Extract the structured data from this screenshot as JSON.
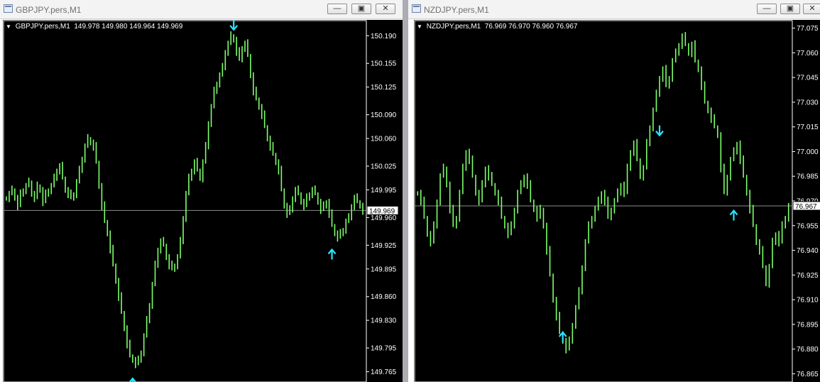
{
  "windows": [
    {
      "id": "left",
      "title": "GBPJPY.pers,M1",
      "header": {
        "symbol": "GBPJPY.pers,M1",
        "open": "149.978",
        "high": "149.980",
        "low": "149.964",
        "close": "149.969"
      },
      "current_price": "149.969",
      "axis_labels": [
        "150.190",
        "150.155",
        "150.125",
        "150.090",
        "150.060",
        "150.025",
        "149.995",
        "149.960",
        "149.925",
        "149.895",
        "149.860",
        "149.830",
        "149.795",
        "149.765"
      ],
      "axis_range": [
        149.752,
        150.21
      ],
      "buttons": {
        "minimize": "—",
        "maximize": "▣",
        "close": "✕"
      },
      "series": [
        149.985,
        149.99,
        149.995,
        149.985,
        149.975,
        149.99,
        149.995,
        150.0,
        150.005,
        149.99,
        149.985,
        150.0,
        149.995,
        149.98,
        149.99,
        149.995,
        150.0,
        150.01,
        150.02,
        150.025,
        150.01,
        149.995,
        149.99,
        149.985,
        149.99,
        150.005,
        150.02,
        150.035,
        150.05,
        150.06,
        150.055,
        150.05,
        150.03,
        150.0,
        149.975,
        149.955,
        149.94,
        149.92,
        149.9,
        149.88,
        149.86,
        149.84,
        149.82,
        149.8,
        149.785,
        149.78,
        149.775,
        149.78,
        149.79,
        149.81,
        149.83,
        149.85,
        149.875,
        149.9,
        149.92,
        149.93,
        149.925,
        149.91,
        149.9,
        149.895,
        149.9,
        149.91,
        149.93,
        149.96,
        149.99,
        150.01,
        150.02,
        150.03,
        150.02,
        150.01,
        150.03,
        150.05,
        150.08,
        150.1,
        150.12,
        150.13,
        150.14,
        150.15,
        150.17,
        150.18,
        150.19,
        150.185,
        150.17,
        150.16,
        150.175,
        150.18,
        150.165,
        150.14,
        150.12,
        150.11,
        150.1,
        150.09,
        150.075,
        150.06,
        150.05,
        150.04,
        150.03,
        150.02,
        149.995,
        149.975,
        149.965,
        149.97,
        149.985,
        149.995,
        149.99,
        149.98,
        149.975,
        149.985,
        149.99,
        149.995,
        149.99,
        149.98,
        149.97,
        149.975,
        149.98,
        149.965,
        149.95,
        149.94,
        149.935,
        149.94,
        149.945,
        149.955,
        149.96,
        149.975,
        149.985,
        149.98,
        149.975,
        149.969
      ],
      "arrows": [
        {
          "direction": "up",
          "index": 45,
          "price": 149.752
        },
        {
          "direction": "down",
          "index": 81,
          "price": 150.202
        },
        {
          "direction": "up",
          "index": 116,
          "price": 149.915
        }
      ]
    },
    {
      "id": "right",
      "title": "NZDJPY.pers,M1",
      "header": {
        "symbol": "NZDJPY.pers,M1",
        "open": "76.969",
        "high": "76.970",
        "low": "76.960",
        "close": "76.967"
      },
      "current_price": "76.967",
      "axis_labels": [
        "77.075",
        "77.060",
        "77.045",
        "77.030",
        "77.015",
        "77.000",
        "76.985",
        "76.970",
        "76.955",
        "76.940",
        "76.925",
        "76.910",
        "76.895",
        "76.880",
        "76.865"
      ],
      "axis_range": [
        76.86,
        77.08
      ],
      "buttons": {
        "minimize": "—",
        "maximize": "▣",
        "close": "✕"
      },
      "series": [
        76.975,
        76.97,
        76.96,
        76.95,
        76.945,
        76.955,
        76.97,
        76.985,
        76.99,
        76.98,
        76.965,
        76.955,
        76.96,
        76.975,
        76.99,
        77.0,
        76.995,
        76.985,
        76.975,
        76.97,
        76.98,
        76.99,
        76.985,
        76.98,
        76.975,
        76.97,
        76.96,
        76.955,
        76.95,
        76.955,
        76.965,
        76.975,
        76.98,
        76.985,
        76.98,
        76.97,
        76.965,
        76.96,
        76.965,
        76.955,
        76.94,
        76.925,
        76.91,
        76.9,
        76.89,
        76.885,
        76.88,
        76.885,
        76.895,
        76.905,
        76.915,
        76.93,
        76.945,
        76.955,
        76.96,
        76.965,
        76.97,
        76.975,
        76.97,
        76.96,
        76.965,
        76.97,
        76.975,
        76.98,
        76.975,
        76.99,
        77.0,
        77.005,
        76.995,
        76.985,
        76.99,
        77.005,
        77.015,
        77.025,
        77.035,
        77.045,
        77.05,
        77.04,
        77.045,
        77.055,
        77.06,
        77.065,
        77.07,
        77.065,
        77.06,
        77.065,
        77.055,
        77.05,
        77.04,
        77.03,
        77.025,
        77.02,
        77.015,
        77.01,
        76.99,
        76.975,
        76.985,
        76.995,
        77.0,
        77.005,
        76.995,
        76.985,
        76.975,
        76.965,
        76.955,
        76.945,
        76.94,
        76.93,
        76.92,
        76.93,
        76.945,
        76.95,
        76.945,
        76.955,
        76.96,
        76.967
      ],
      "arrows": [
        {
          "direction": "down",
          "index": 75,
          "price": 77.012
        },
        {
          "direction": "up",
          "index": 45,
          "price": 76.888
        },
        {
          "direction": "up",
          "index": 98,
          "price": 76.962
        }
      ]
    }
  ]
}
